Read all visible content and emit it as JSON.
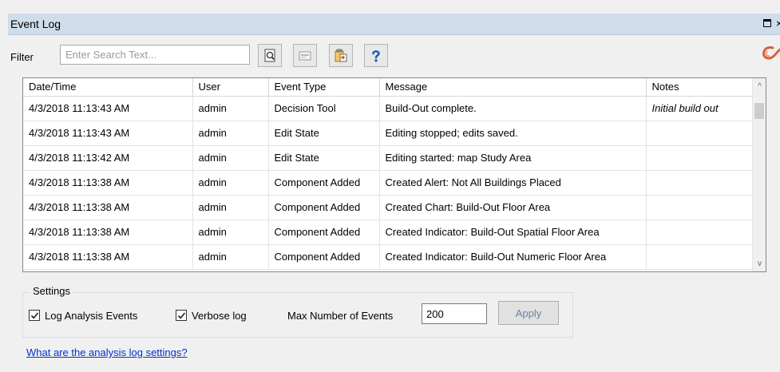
{
  "window": {
    "title": "Event Log",
    "restore_glyph": "",
    "close_glyph": "×"
  },
  "filter": {
    "label": "Filter",
    "search_placeholder": "Enter Search Text...",
    "tools": [
      "search-log-icon",
      "clear-filter-icon",
      "export-log-icon",
      "help-question-icon"
    ]
  },
  "grid": {
    "columns": [
      "Date/Time",
      "User",
      "Event Type",
      "Message",
      "Notes"
    ],
    "rows": [
      [
        "4/3/2018 11:13:43 AM",
        "admin",
        "Decision Tool",
        "Build-Out complete.",
        "Initial build out"
      ],
      [
        "4/3/2018 11:13:43 AM",
        "admin",
        "Edit State",
        "Editing stopped; edits saved.",
        ""
      ],
      [
        "4/3/2018 11:13:42 AM",
        "admin",
        "Edit State",
        "Editing started: map Study Area",
        ""
      ],
      [
        "4/3/2018 11:13:38 AM",
        "admin",
        "Component Added",
        "Created Alert: Not All Buildings Placed",
        ""
      ],
      [
        "4/3/2018 11:13:38 AM",
        "admin",
        "Component Added",
        "Created Chart: Build-Out Floor Area",
        ""
      ],
      [
        "4/3/2018 11:13:38 AM",
        "admin",
        "Component Added",
        "Created Indicator: Build-Out Spatial Floor Area",
        ""
      ],
      [
        "4/3/2018 11:13:38 AM",
        "admin",
        "Component Added",
        "Created Indicator: Build-Out Numeric Floor Area",
        ""
      ]
    ],
    "scroll_up": "^",
    "scroll_down": "v"
  },
  "settings": {
    "legend": "Settings",
    "log_analysis_label": "Log Analysis Events",
    "log_analysis_checked": true,
    "verbose_label": "Verbose log",
    "verbose_checked": true,
    "max_events_label": "Max Number of Events",
    "max_events_value": "200",
    "apply_label": "Apply"
  },
  "help_link": "What are the analysis log settings?",
  "colors": {
    "titlebar": "#cfdcea",
    "link": "#0033cc",
    "apply_text": "#6d7fa8"
  }
}
